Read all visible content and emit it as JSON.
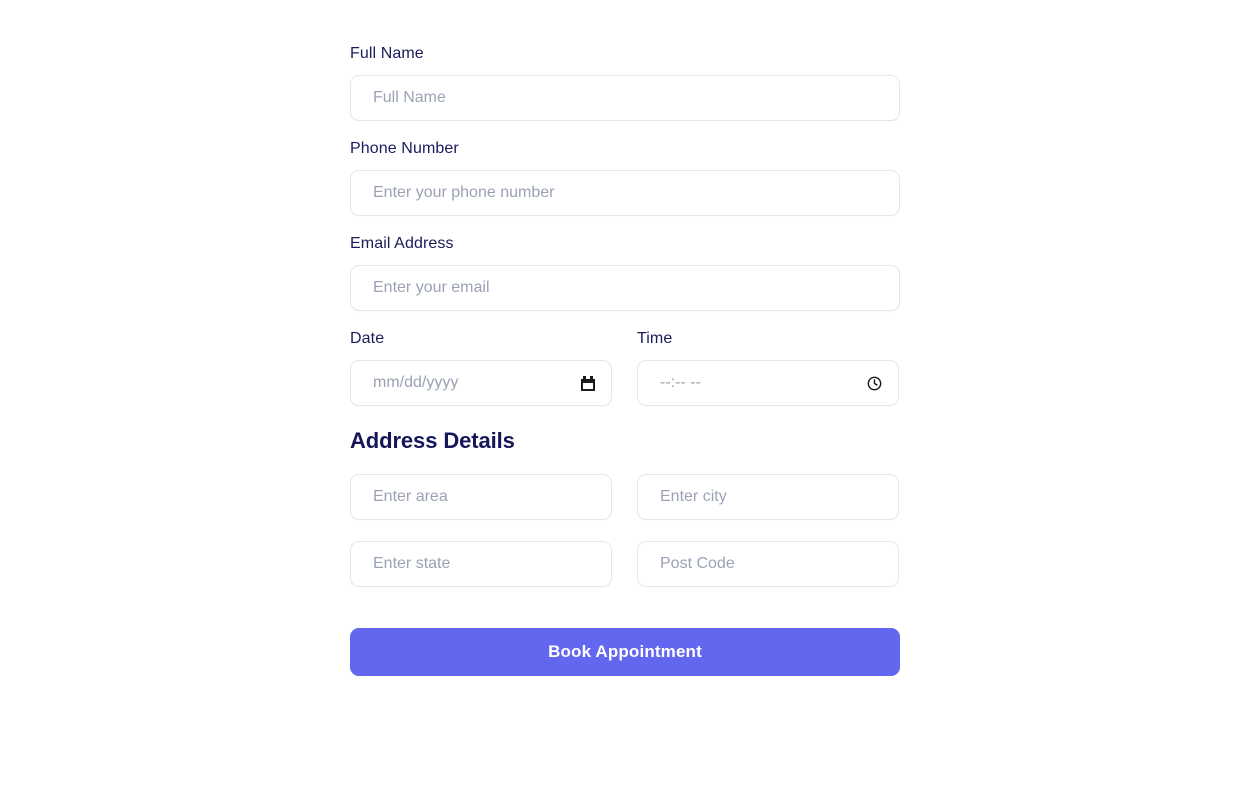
{
  "form": {
    "fields": [
      {
        "id": "full-name",
        "label": "Full Name",
        "placeholder": "Full Name",
        "value": ""
      },
      {
        "id": "phone-number",
        "label": "Phone Number",
        "placeholder": "Enter your phone number",
        "value": ""
      },
      {
        "id": "email-address",
        "label": "Email Address",
        "placeholder": "Enter your email",
        "value": ""
      }
    ],
    "date_field": {
      "id": "date",
      "label": "Date",
      "placeholder": "mm/dd/yyyy",
      "value": "",
      "icon": "calendar-icon"
    },
    "time_field": {
      "id": "time",
      "label": "Time",
      "placeholder": "--:-- --",
      "value": "",
      "icon": "clock-icon"
    },
    "address_section": {
      "heading": "Address Details",
      "fields": [
        {
          "id": "area",
          "placeholder": "Enter area",
          "value": ""
        },
        {
          "id": "city",
          "placeholder": "Enter city",
          "value": ""
        },
        {
          "id": "state",
          "placeholder": "Enter state",
          "value": ""
        },
        {
          "id": "post-code",
          "placeholder": "Post Code",
          "value": ""
        }
      ]
    },
    "submit": {
      "label": "Book Appointment"
    }
  },
  "colors": {
    "label_text": "#1b1b5c",
    "heading_text": "#16165a",
    "placeholder_text": "#9aa2b4",
    "input_border": "#e3e6eb",
    "accent": "#6366ef",
    "button_text": "#ffffff",
    "background": "#ffffff"
  }
}
